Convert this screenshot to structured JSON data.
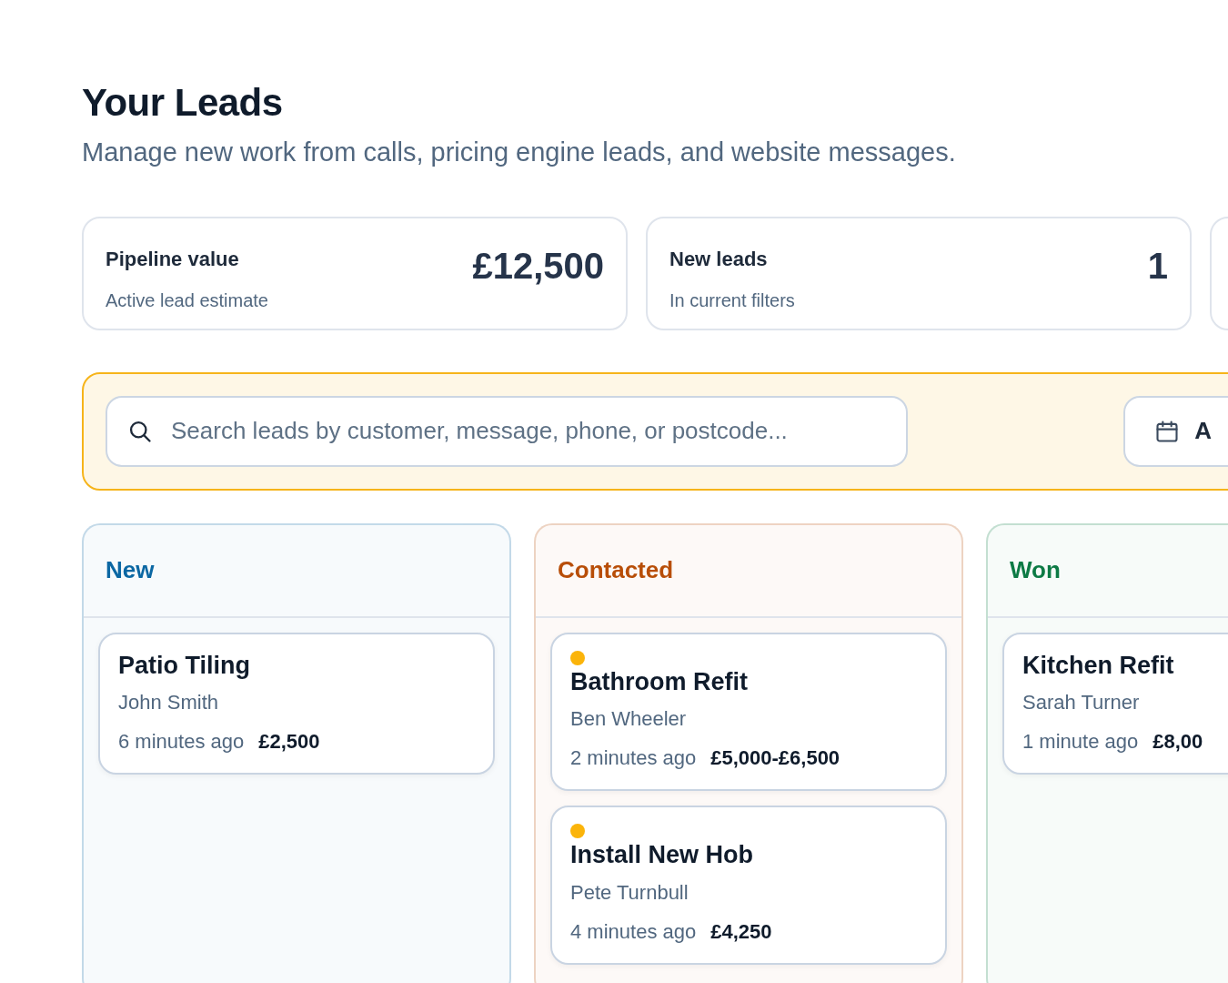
{
  "page": {
    "title": "Your Leads",
    "subtitle": "Manage new work from calls, pricing engine leads, and website messages."
  },
  "stats": [
    {
      "label": "Pipeline value",
      "caption": "Active lead estimate",
      "value": "£12,500"
    },
    {
      "label": "New leads",
      "caption": "In current filters",
      "value": "1"
    }
  ],
  "filters": {
    "search": {
      "placeholder": "Search leads by customer, message, phone, or postcode..."
    },
    "date_button": {
      "label": "A"
    }
  },
  "columns": [
    {
      "title": "New",
      "color": "#0b67a3",
      "cards": [
        {
          "title": "Patio Tiling",
          "customer": "John Smith",
          "time": "6 minutes ago",
          "price": "£2,500"
        }
      ]
    },
    {
      "title": "Contacted",
      "color": "#b84e08",
      "cards": [
        {
          "title": "Bathroom Refit",
          "customer": "Ben Wheeler",
          "time": "2 minutes ago",
          "price": "£5,000-£6,500",
          "color": "#fbb40a"
        },
        {
          "title": "Install New Hob",
          "customer": "Pete Turnbull",
          "time": "4 minutes ago",
          "price": "£4,250",
          "color": "#fbb40a"
        }
      ]
    },
    {
      "title": "Won",
      "color": "#0d7a45",
      "cards": [
        {
          "title": "Kitchen Refit",
          "customer": "Sarah Turner",
          "time": "1 minute ago",
          "price": "£8,00"
        }
      ]
    }
  ]
}
